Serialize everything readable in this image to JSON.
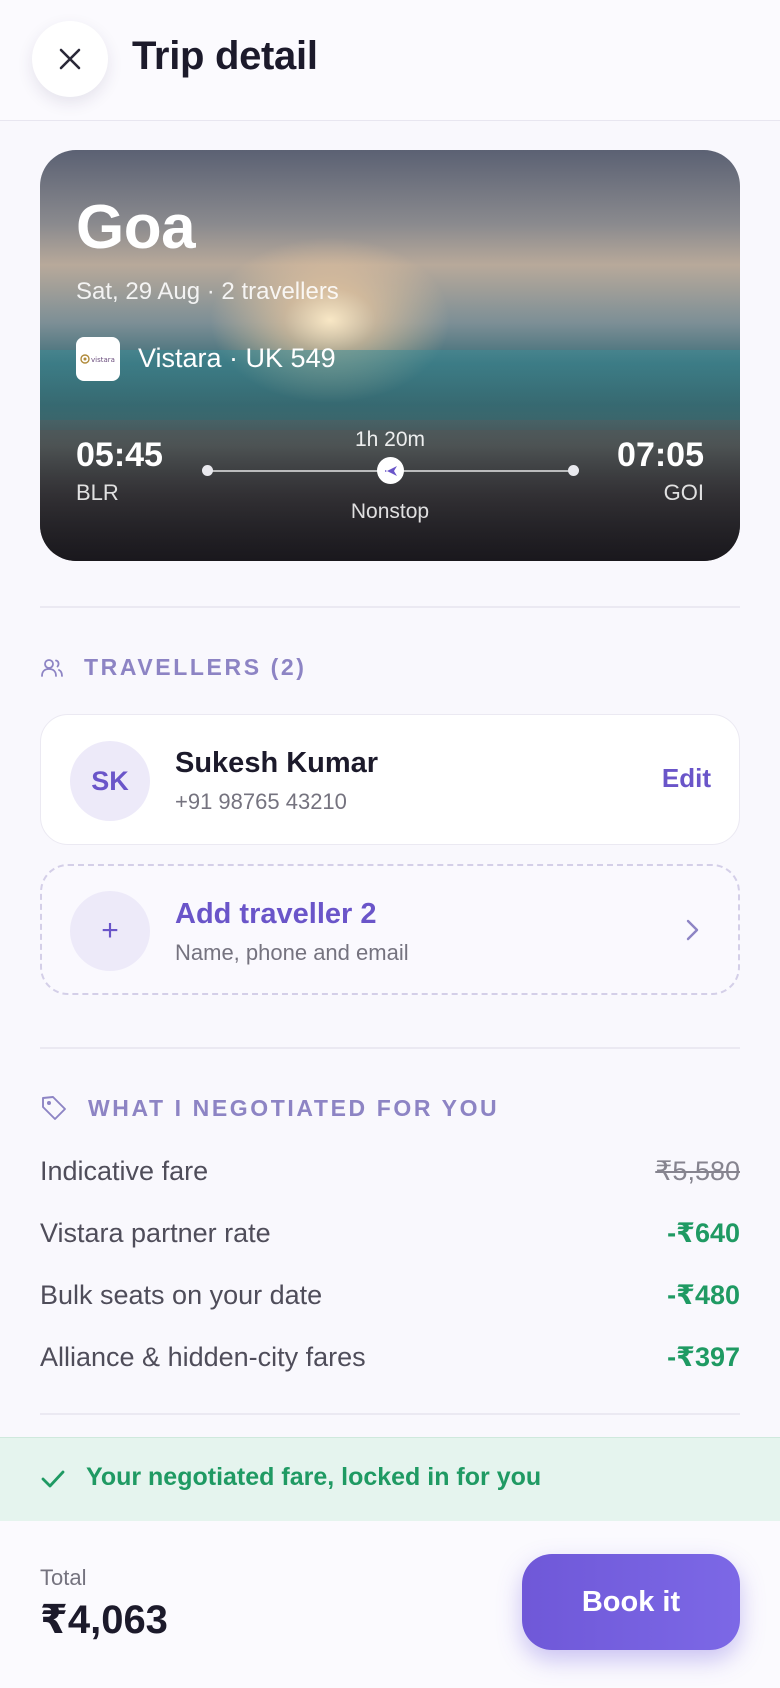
{
  "header": {
    "title": "Trip detail",
    "close_icon": "close-icon"
  },
  "trip": {
    "city": "Goa",
    "subtitle": "Sat, 29 Aug · 2 travellers",
    "airline": "Vistara · UK 549",
    "airline_logo_text": "vistara",
    "departure_time": "05:45",
    "departure_code": "BLR",
    "arrival_time": "07:05",
    "arrival_code": "GOI",
    "duration": "1h 20m",
    "stops": "Nonstop"
  },
  "travellers": {
    "label": "TRAVELLERS (2)",
    "icon": "users-icon",
    "primary": {
      "initials": "SK",
      "name": "Sukesh Kumar",
      "phone": "+91 98765 43210",
      "edit_label": "Edit"
    },
    "add": {
      "title": "Add traveller 2",
      "subtitle": "Name, phone and email",
      "plus": "+"
    }
  },
  "negotiation": {
    "label": "WHAT I NEGOTIATED FOR YOU",
    "icon": "tag-icon",
    "rows": [
      {
        "label": "Indicative fare",
        "amount": "₹5,580"
      },
      {
        "label": "Vistara partner rate",
        "amount": "-₹640"
      },
      {
        "label": "Bulk seats on your date",
        "amount": "-₹480"
      },
      {
        "label": "Alliance & hidden-city fares",
        "amount": "-₹397"
      }
    ]
  },
  "locked": {
    "text": "Your negotiated fare, locked in for you",
    "icon": "check-icon"
  },
  "footer": {
    "total_label": "Total",
    "total_value": "₹4,063",
    "book_label": "Book it"
  },
  "colors": {
    "accent": "#6a55c9",
    "success": "#1f9a63",
    "section_label": "#8d84c4"
  }
}
